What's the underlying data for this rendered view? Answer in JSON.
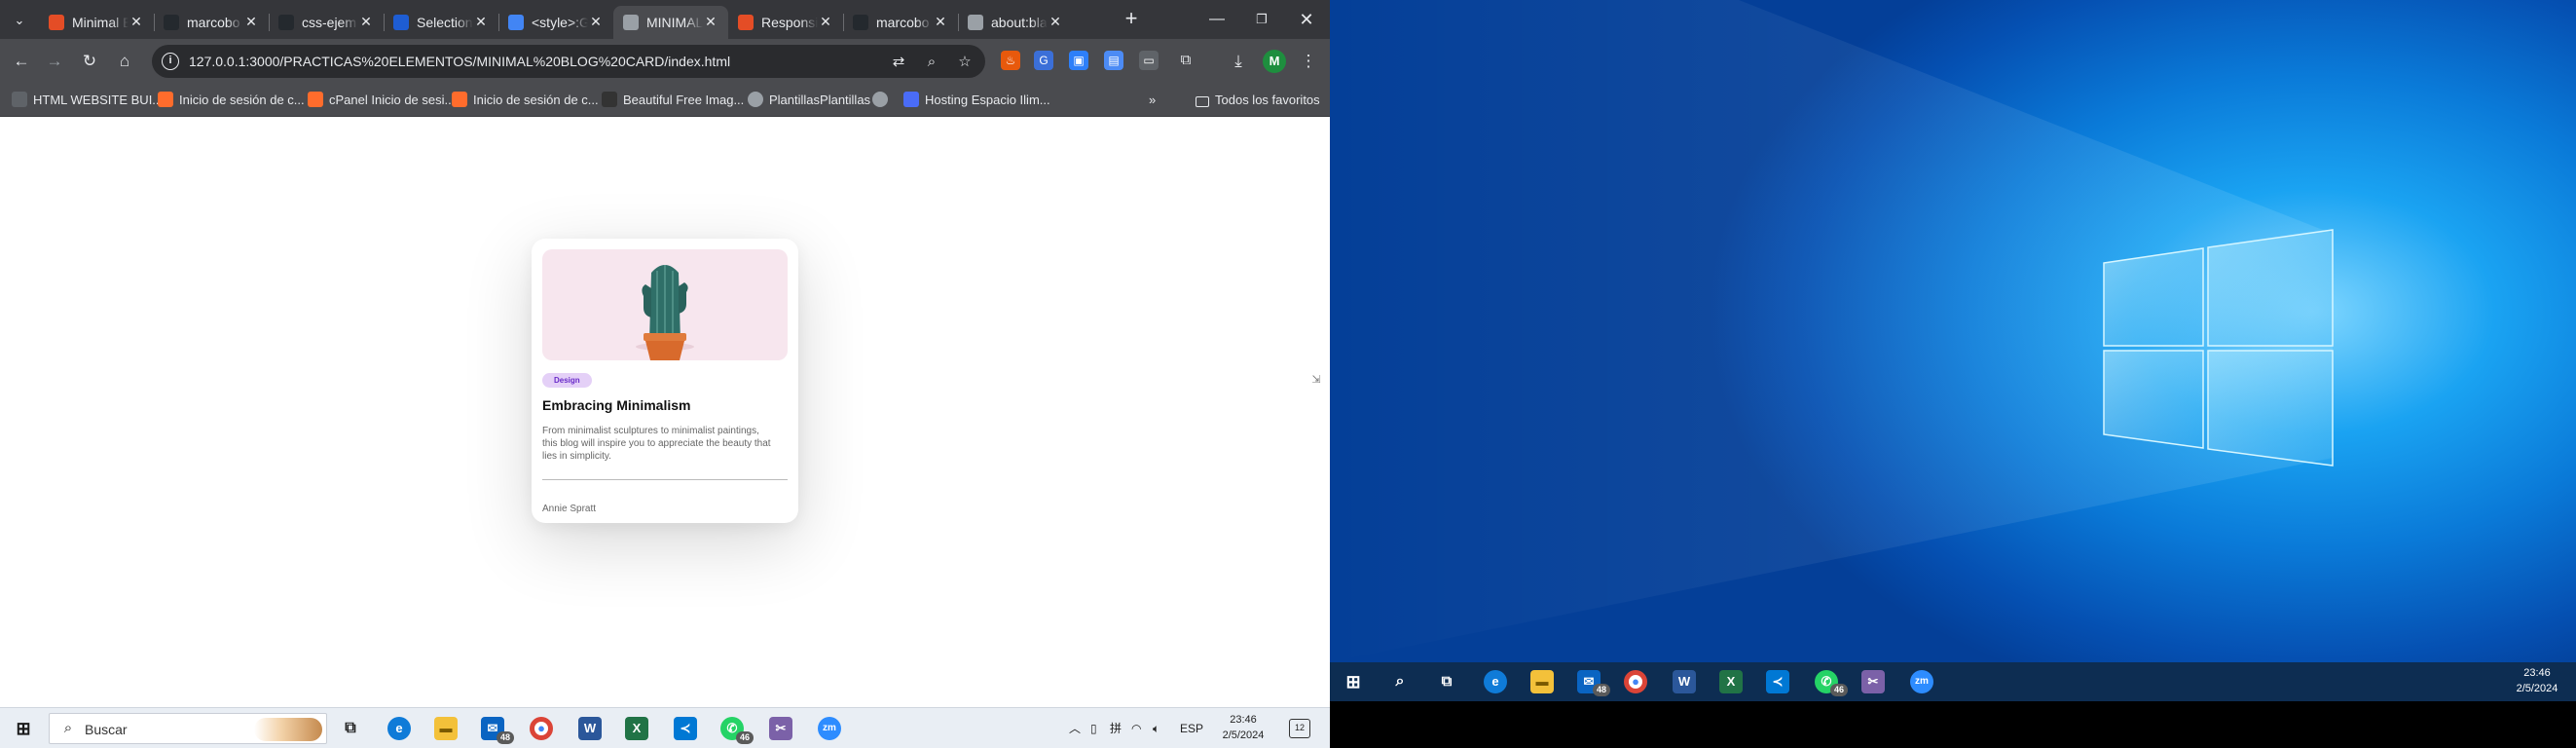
{
  "browser": {
    "tabs": [
      {
        "title": "Minimal B",
        "icon": "html5-icon",
        "color": "#e44d26",
        "active": false
      },
      {
        "title": "marcobo",
        "icon": "github-icon",
        "color": "#24292e",
        "active": false
      },
      {
        "title": "css-ejem",
        "icon": "github-icon",
        "color": "#24292e",
        "active": false
      },
      {
        "title": "Selection",
        "icon": "mdn-icon",
        "color": "#1e5dd3",
        "active": false
      },
      {
        "title": "<style>:G",
        "icon": "google-icon",
        "color": "#4285f4",
        "active": false
      },
      {
        "title": "MINIMAL",
        "icon": "globe-icon",
        "color": "#9aa0a6",
        "active": true
      },
      {
        "title": "Responsi",
        "icon": "html5-icon",
        "color": "#e44d26",
        "active": false
      },
      {
        "title": "marcobo",
        "icon": "github-icon",
        "color": "#24292e",
        "active": false
      },
      {
        "title": "about:bla",
        "icon": "globe-icon",
        "color": "#9aa0a6",
        "active": false
      }
    ],
    "url": "127.0.0.1:3000/PRACTICAS%20ELEMENTOS/MINIMAL%20BLOG%20CARD/index.html",
    "profile_initial": "M",
    "bookmarks": [
      {
        "label": "HTML WEBSITE BUI...",
        "icon": "grid-icon"
      },
      {
        "label": "Inicio de sesión de c...",
        "icon": "cpanel-icon"
      },
      {
        "label": "cPanel Inicio de sesi...",
        "icon": "cpanel-icon"
      },
      {
        "label": "Inicio de sesión de c...",
        "icon": "cpanel-icon"
      },
      {
        "label": "Beautiful Free Imag...",
        "icon": "camera-icon"
      },
      {
        "label": "PlantillasPlantillas",
        "icon": "globe-icon"
      },
      {
        "label": "",
        "icon": "globe-icon"
      },
      {
        "label": "Hosting Espacio Ilim...",
        "icon": "infinity-icon"
      }
    ],
    "bookmarks_more": "»",
    "all_bookmarks": "Todos los favoritos"
  },
  "card": {
    "badge": "Design",
    "title": "Embracing Minimalism",
    "description": "From minimalist sculptures to minimalist paintings, this blog will inspire you to appreciate the beauty that lies in simplicity.",
    "author": "Annie Spratt",
    "image_bg": "#f7e6ee",
    "badge_color": "#6a2cc9"
  },
  "taskbar_left": {
    "search_placeholder": "Buscar",
    "mail_count": "48",
    "whatsapp_count": "46",
    "language": "ESP",
    "time": "23:46",
    "date": "2/5/2024",
    "notifications": "12"
  },
  "taskbar_right": {
    "mail_count": "48",
    "whatsapp_count": "46",
    "time": "23:46",
    "date": "2/5/2024"
  }
}
